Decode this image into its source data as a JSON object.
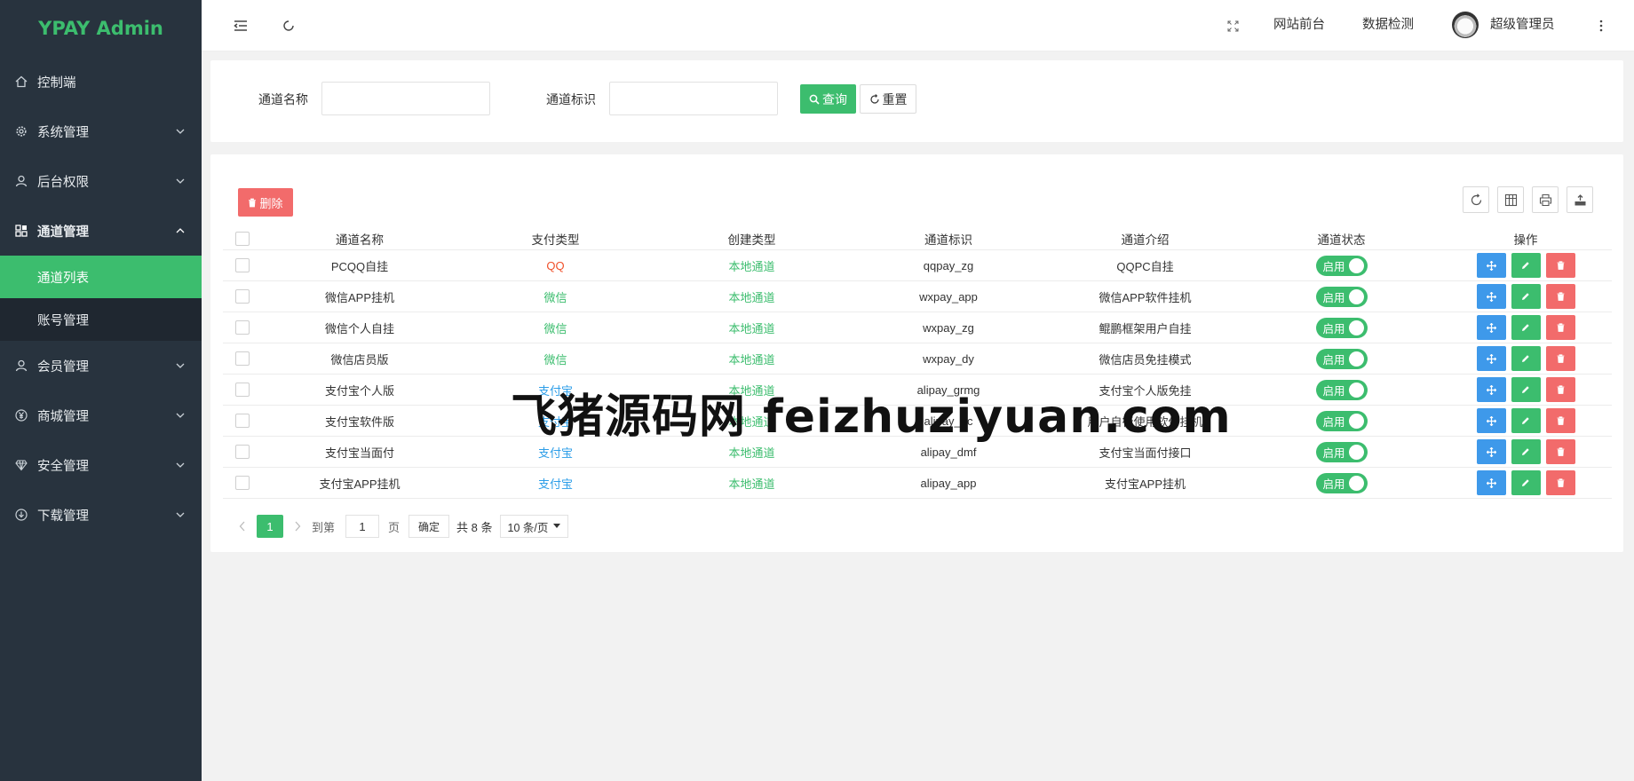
{
  "app": {
    "logo": "YPAY Admin"
  },
  "sidebar": {
    "items": [
      {
        "label": "控制端",
        "icon": "home-icon"
      },
      {
        "label": "系统管理",
        "icon": "gear-icon"
      },
      {
        "label": "后台权限",
        "icon": "user-icon"
      },
      {
        "label": "通道管理",
        "icon": "apps-icon",
        "expanded": true
      },
      {
        "label": "会员管理",
        "icon": "user-icon"
      },
      {
        "label": "商城管理",
        "icon": "yen-icon"
      },
      {
        "label": "安全管理",
        "icon": "diamond-icon"
      },
      {
        "label": "下载管理",
        "icon": "download-icon"
      }
    ],
    "submenu": [
      {
        "label": "通道列表",
        "active": true
      },
      {
        "label": "账号管理",
        "active": false
      }
    ]
  },
  "header": {
    "links": [
      "网站前台",
      "数据检测"
    ],
    "user": "超级管理员"
  },
  "search": {
    "name_label": "通道名称",
    "name_value": "",
    "id_label": "通道标识",
    "id_value": "",
    "query_label": "查询",
    "reset_label": "重置"
  },
  "table": {
    "delete_label": "删除",
    "columns": [
      "通道名称",
      "支付类型",
      "创建类型",
      "通道标识",
      "通道介绍",
      "通道状态",
      "操作"
    ],
    "rows": [
      {
        "name": "PCQQ自挂",
        "pay": "QQ",
        "create": "本地通道",
        "code": "qqpay_zg",
        "desc": "QQPC自挂",
        "status": "启用"
      },
      {
        "name": "微信APP挂机",
        "pay": "微信",
        "create": "本地通道",
        "code": "wxpay_app",
        "desc": "微信APP软件挂机",
        "status": "启用"
      },
      {
        "name": "微信个人自挂",
        "pay": "微信",
        "create": "本地通道",
        "code": "wxpay_zg",
        "desc": "鲲鹏框架用户自挂",
        "status": "启用"
      },
      {
        "name": "微信店员版",
        "pay": "微信",
        "create": "本地通道",
        "code": "wxpay_dy",
        "desc": "微信店员免挂模式",
        "status": "启用"
      },
      {
        "name": "支付宝个人版",
        "pay": "支付宝",
        "create": "本地通道",
        "code": "alipay_grmg",
        "desc": "支付宝个人版免挂",
        "status": "启用"
      },
      {
        "name": "支付宝软件版",
        "pay": "支付宝",
        "create": "本地通道",
        "code": "alipay_pc",
        "desc": "用户自行使用软件挂机",
        "status": "启用"
      },
      {
        "name": "支付宝当面付",
        "pay": "支付宝",
        "create": "本地通道",
        "code": "alipay_dmf",
        "desc": "支付宝当面付接口",
        "status": "启用"
      },
      {
        "name": "支付宝APP挂机",
        "pay": "支付宝",
        "create": "本地通道",
        "code": "alipay_app",
        "desc": "支付宝APP挂机",
        "status": "启用"
      }
    ]
  },
  "pager": {
    "current": "1",
    "goto_label": "到第",
    "goto_value": "1",
    "page_suffix": "页",
    "confirm": "确定",
    "total": "共 8 条",
    "page_size": "10 条/页"
  },
  "watermark": "飞猪源码网 feizhuziyuan.com",
  "colors": {
    "accent": "#3cbd6e",
    "sidebar": "#28333e",
    "danger": "#f26b6b",
    "info": "#3e99ea",
    "qq": "#f0502a",
    "wechat": "#3cbd6e",
    "alipay": "#2d9ee8"
  }
}
